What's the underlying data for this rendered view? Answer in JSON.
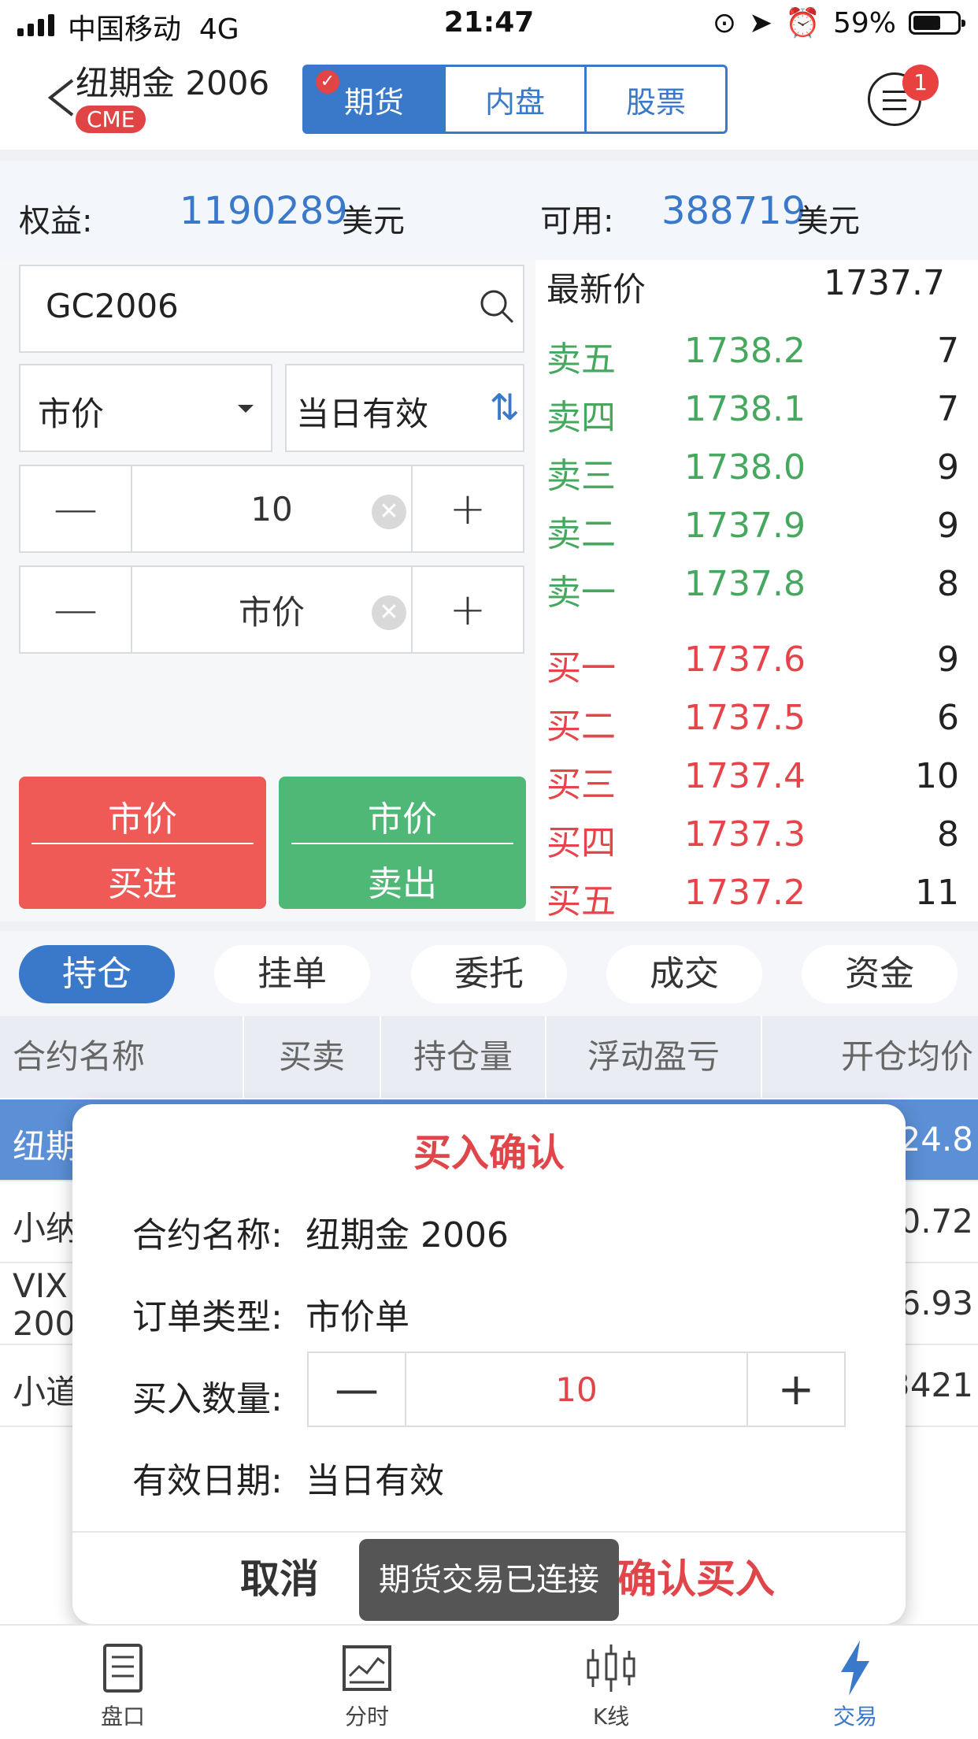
{
  "status": {
    "carrier": "中国移动",
    "network": "4G",
    "time": "21:47",
    "battery": "59%"
  },
  "nav": {
    "title": "纽期金 2006",
    "exchange_badge": "CME",
    "tabs": [
      "期货",
      "内盘",
      "股票"
    ],
    "notification_count": "1"
  },
  "account": {
    "equity_label": "权益:",
    "equity_value": "1190289",
    "equity_unit": "美元",
    "available_label": "可用:",
    "available_value": "388719",
    "available_unit": "美元"
  },
  "order": {
    "code": "GC2006",
    "order_type": "市价",
    "validity": "当日有效",
    "quantity": "10",
    "price": "市价"
  },
  "buttons": {
    "buy_top": "市价",
    "buy_bottom": "买进",
    "sell_top": "市价",
    "sell_bottom": "卖出"
  },
  "quotes": {
    "last_label": "最新价",
    "last_price": "1737.7",
    "asks": [
      {
        "name": "卖五",
        "price": "1738.2",
        "vol": "7"
      },
      {
        "name": "卖四",
        "price": "1738.1",
        "vol": "7"
      },
      {
        "name": "卖三",
        "price": "1738.0",
        "vol": "9"
      },
      {
        "name": "卖二",
        "price": "1737.9",
        "vol": "9"
      },
      {
        "name": "卖一",
        "price": "1737.8",
        "vol": "8"
      }
    ],
    "bids": [
      {
        "name": "买一",
        "price": "1737.6",
        "vol": "9"
      },
      {
        "name": "买二",
        "price": "1737.5",
        "vol": "6"
      },
      {
        "name": "买三",
        "price": "1737.4",
        "vol": "10"
      },
      {
        "name": "买四",
        "price": "1737.3",
        "vol": "8"
      },
      {
        "name": "买五",
        "price": "1737.2",
        "vol": "11"
      }
    ]
  },
  "position_tabs": [
    "持仓",
    "挂单",
    "委托",
    "成交",
    "资金"
  ],
  "table": {
    "headers": [
      "合约名称",
      "买卖",
      "持仓量",
      "浮动盈亏",
      "开仓均价"
    ],
    "rows": [
      {
        "name": "纽期",
        "avg": "24.8"
      },
      {
        "name": "小纳",
        "avg": "0.72"
      },
      {
        "name": "VIX",
        "name2": "200",
        "avg": "6.93"
      },
      {
        "name": "小道",
        "avg": "3421"
      }
    ]
  },
  "dialog": {
    "title": "买入确认",
    "contract_label": "合约名称:",
    "contract_value": "纽期金 2006",
    "type_label": "订单类型:",
    "type_value": "市价单",
    "qty_label": "买入数量:",
    "qty_value": "10",
    "date_label": "有效日期:",
    "date_value": "当日有效",
    "cancel": "取消",
    "confirm": "确认买入"
  },
  "toast": "期货交易已连接",
  "bottom_nav": [
    "盘口",
    "分时",
    "K线",
    "交易"
  ],
  "colors": {
    "accent": "#3a78c9",
    "buy": "#ef5a56",
    "sell": "#4fb877",
    "ask_text": "#45a85e",
    "bid_text": "#e5454a"
  }
}
